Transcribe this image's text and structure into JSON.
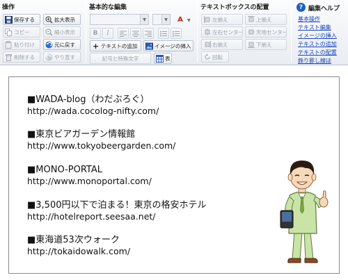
{
  "toolbar": {
    "ops": {
      "title": "操作",
      "save": "保存する",
      "zoom_in": "拡大表示",
      "copy": "コピー",
      "zoom_out": "縮小表示",
      "paste": "貼り付け",
      "undo": "元に戻す",
      "delete": "削除する",
      "redo": "やり直す"
    },
    "basic": {
      "title": "基本的な編集",
      "bold": "B",
      "italic": "I",
      "font_color_glyph": "A",
      "add_text": "テキストの追加",
      "insert_image": "イメージの挿入",
      "symbols": "記号と特殊文字",
      "table": "表"
    },
    "layout": {
      "title": "テキストボックスの配置",
      "align_left": "左揃え",
      "align_top": "上揃え",
      "left_center": "左右センター",
      "top_center": "天地センター",
      "align_right": "右揃え",
      "align_bottom": "下揃え",
      "rotate": "回転"
    },
    "help": {
      "title": "編集ヘルプ",
      "icon_glyph": "?",
      "links": [
        "基本操作",
        "テキスト編集",
        "イメージの挿入",
        "テキストの追加",
        "テキストの配置",
        "飾り罫し線ほ"
      ]
    }
  },
  "content": {
    "entries": [
      {
        "title": "■WADA-blog（わだぶろぐ）",
        "url": "http://wada.cocolog-nifty.com/"
      },
      {
        "title": "■東京ビアガーデン情報館",
        "url": "http://www.tokyobeergarden.com/"
      },
      {
        "title": "■MONO-PORTAL",
        "url": "http://www.monoportal.com/"
      },
      {
        "title": "■3,500円以下で泊まる！東京の格安ホテル",
        "url": "http://hotelreport.seesaa.net/"
      },
      {
        "title": "■東海道53次ウォーク",
        "url": "http://tokaidowalk.com/"
      }
    ]
  },
  "colors": {
    "link": "#1a45c4",
    "help_icon": "#1f5fc4",
    "font_color_red": "#d11a1a"
  }
}
